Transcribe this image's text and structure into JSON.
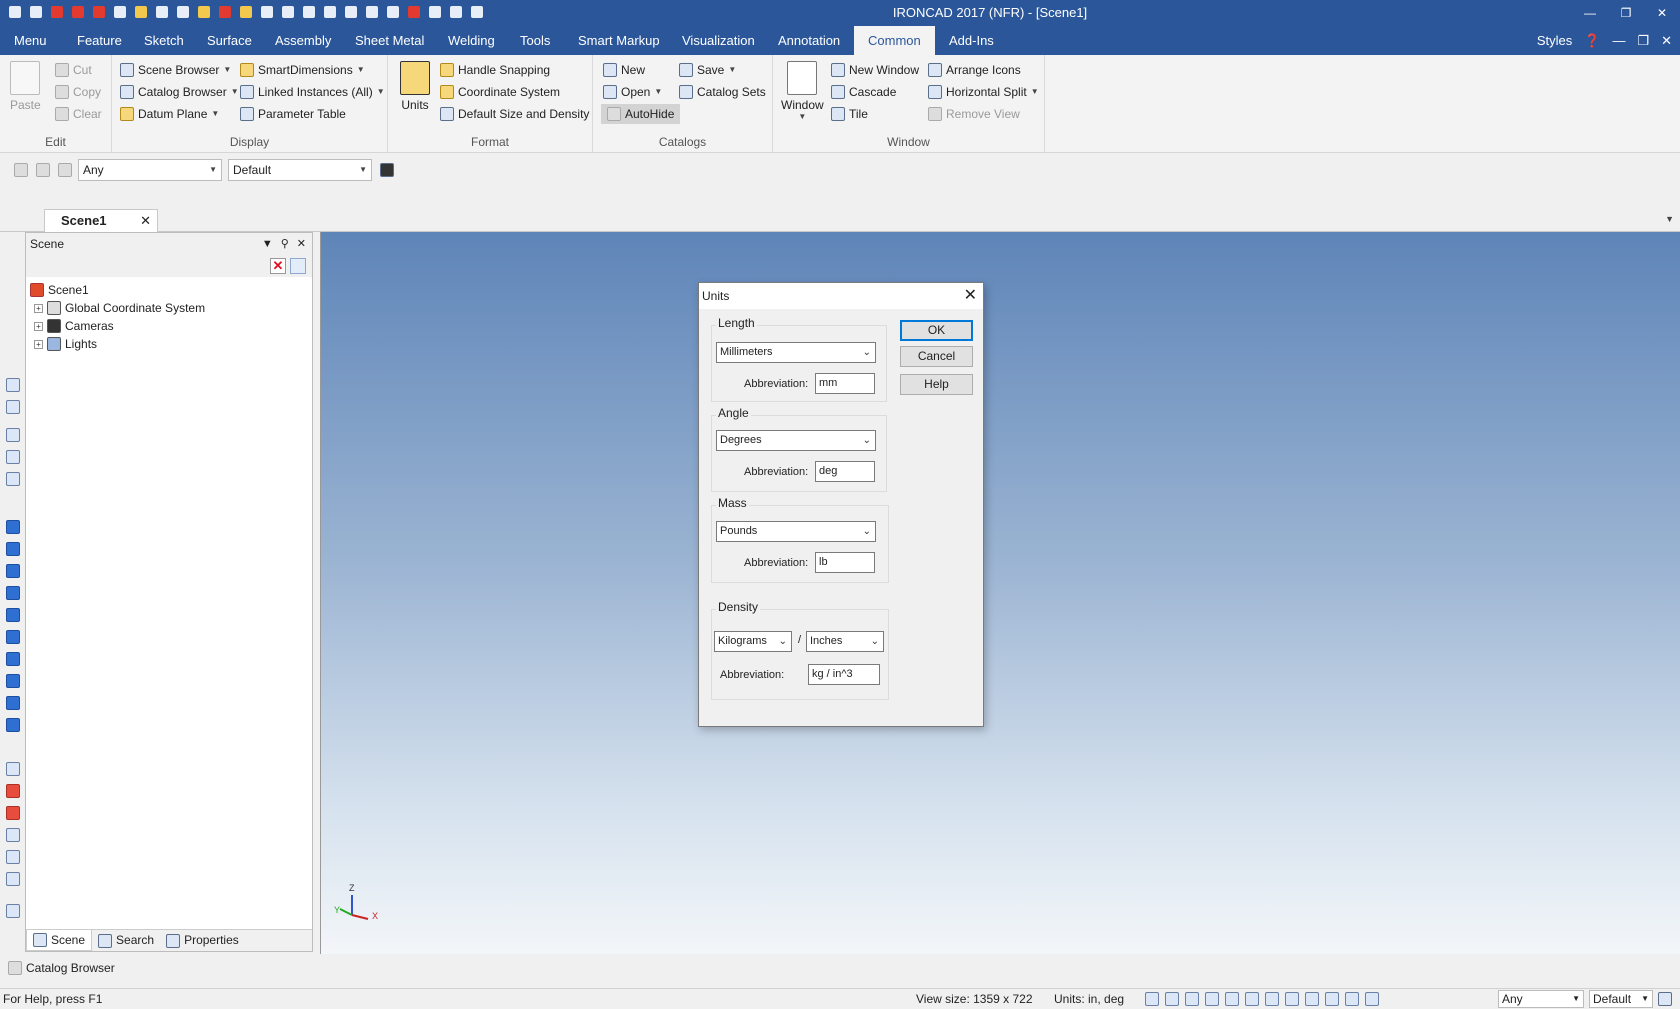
{
  "window": {
    "title": "IRONCAD 2017 (NFR) - [Scene1]",
    "minimize_icon": "minimize-icon",
    "restore_icon": "restore-icon",
    "close_icon": "close-icon"
  },
  "ribbon_tabs": [
    "Menu",
    "Feature",
    "Sketch",
    "Surface",
    "Assembly",
    "Sheet Metal",
    "Welding",
    "Tools",
    "Smart Markup",
    "Visualization",
    "Annotation",
    "Common",
    "Add-Ins"
  ],
  "active_tab": "Common",
  "styles_label": "Styles",
  "ribbon": {
    "edit": {
      "label": "Edit",
      "paste": "Paste",
      "cut": "Cut",
      "copy": "Copy",
      "clear": "Clear"
    },
    "display": {
      "label": "Display",
      "scene_browser": "Scene Browser",
      "catalog_browser": "Catalog Browser",
      "datum_plane": "Datum Plane",
      "smart_dimensions": "SmartDimensions",
      "linked_instances": "Linked Instances (All)",
      "parameter_table": "Parameter Table"
    },
    "format": {
      "label": "Format",
      "units": "Units",
      "handle_snapping": "Handle Snapping",
      "coordinate_system": "Coordinate System",
      "default_size_density": "Default Size and Density"
    },
    "catalogs": {
      "label": "Catalogs",
      "new": "New",
      "open": "Open",
      "autohide": "AutoHide",
      "save": "Save",
      "catalog_sets": "Catalog Sets"
    },
    "window": {
      "label": "Window",
      "window": "Window",
      "new_window": "New Window",
      "cascade": "Cascade",
      "tile": "Tile",
      "arrange_icons": "Arrange Icons",
      "horizontal_split": "Horizontal Split",
      "remove_view": "Remove View"
    }
  },
  "selection_bar": {
    "filter_value": "Any",
    "style_value": "Default"
  },
  "doc_tab": "Scene1",
  "scene_panel": {
    "title": "Scene",
    "tree": [
      {
        "label": "Scene1"
      },
      {
        "label": "Global Coordinate System"
      },
      {
        "label": "Cameras"
      },
      {
        "label": "Lights"
      }
    ],
    "tabs": [
      "Scene",
      "Search",
      "Properties"
    ]
  },
  "catalog_browser_label": "Catalog Browser",
  "status": {
    "help": "For Help, press F1",
    "view_size": "View size: 1359 x  722",
    "units": "Units: in, deg",
    "filter_value": "Any",
    "style_value": "Default"
  },
  "triad": {
    "z": "Z",
    "y": "Y",
    "x": "X"
  },
  "dialog": {
    "title": "Units",
    "length": {
      "label": "Length",
      "value": "Millimeters",
      "abbr_label": "Abbreviation:",
      "abbr": "mm"
    },
    "angle": {
      "label": "Angle",
      "value": "Degrees",
      "abbr_label": "Abbreviation:",
      "abbr": "deg"
    },
    "mass": {
      "label": "Mass",
      "value": "Pounds",
      "abbr_label": "Abbreviation:",
      "abbr": "lb"
    },
    "density": {
      "label": "Density",
      "mass_unit": "Kilograms",
      "separator": "/",
      "length_unit": "Inches",
      "abbr_label": "Abbreviation:",
      "abbr": "kg / in^3"
    },
    "ok": "OK",
    "cancel": "Cancel",
    "help": "Help"
  }
}
